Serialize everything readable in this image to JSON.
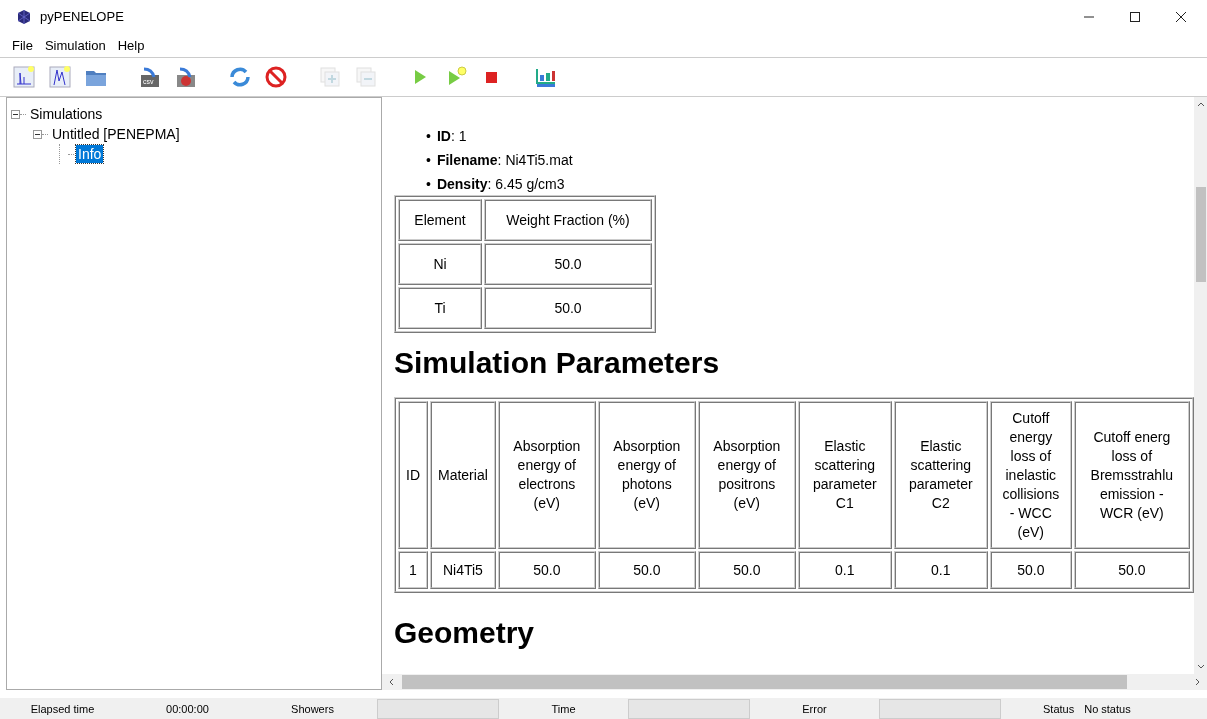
{
  "window": {
    "title": "pyPENELOPE"
  },
  "menu": [
    "File",
    "Simulation",
    "Help"
  ],
  "toolbar": [
    {
      "kind": "spectrum",
      "disabled": false
    },
    {
      "kind": "spectrum2",
      "disabled": false
    },
    {
      "kind": "folder",
      "disabled": false
    },
    {
      "kind": "csv",
      "disabled": false
    },
    {
      "kind": "export",
      "disabled": false
    },
    {
      "kind": "refresh",
      "disabled": false
    },
    {
      "kind": "stop-sign",
      "disabled": false
    },
    {
      "kind": "add",
      "disabled": true
    },
    {
      "kind": "remove",
      "disabled": true
    },
    {
      "kind": "play",
      "disabled": false
    },
    {
      "kind": "play-star",
      "disabled": false
    },
    {
      "kind": "stop",
      "disabled": false
    },
    {
      "kind": "chart",
      "disabled": false
    }
  ],
  "tree": [
    {
      "label": "Simulations",
      "expanded": true,
      "selected": false,
      "children": [
        {
          "label": "Untitled [PENEPMA]",
          "expanded": true,
          "selected": false,
          "children": [
            {
              "label": "Info",
              "selected": true
            }
          ]
        }
      ]
    }
  ],
  "info": [
    {
      "marker": "•",
      "text": "**ID**: 1"
    },
    {
      "marker": "•",
      "text": "**Filename**: Ni4Ti5.mat"
    },
    {
      "marker": "•",
      "text": "**Density**: 6.45 g/cm3"
    }
  ],
  "composition": {
    "columns": [
      "Element",
      "Weight Fraction (%)"
    ],
    "rows": [
      [
        "Ni",
        "50.0"
      ],
      [
        "Ti",
        "50.0"
      ]
    ]
  },
  "sections": [
    "Simulation Parameters",
    "Geometry"
  ],
  "parameters": {
    "columns": [
      "ID",
      "Material",
      "Absorption\nenergy of\nelectrons\n(eV)",
      "Absorption\nenergy of\nphotons\n(eV)",
      "Absorption\nenergy of\npositrons\n(eV)",
      "Elastic\nscattering\nparameter\nC1",
      "Elastic\nscattering\nparameter\nC2",
      "Cutoff\nenergy\nloss of\ninelastic\ncollisions\n- WCC\n(eV)",
      "Cutoff energ\nloss of\nBremsstrahlu\nemission -\nWCR (eV)"
    ],
    "rows": [
      [
        "1",
        "Ni4Ti5",
        "50.0",
        "50.0",
        "50.0",
        "0.1",
        "0.1",
        "50.0",
        "50.0"
      ]
    ]
  },
  "status_bar": [
    {
      "kind": "text",
      "text": "Elapsed time"
    },
    {
      "kind": "text",
      "text": "00:00:00"
    },
    {
      "kind": "text",
      "text": "Showers"
    },
    {
      "kind": "box"
    },
    {
      "kind": "text",
      "text": "Time"
    },
    {
      "kind": "box"
    },
    {
      "kind": "text",
      "text": "Error"
    },
    {
      "kind": "box"
    },
    {
      "kind": "pair",
      "text": "Status",
      "value": "No status"
    }
  ]
}
